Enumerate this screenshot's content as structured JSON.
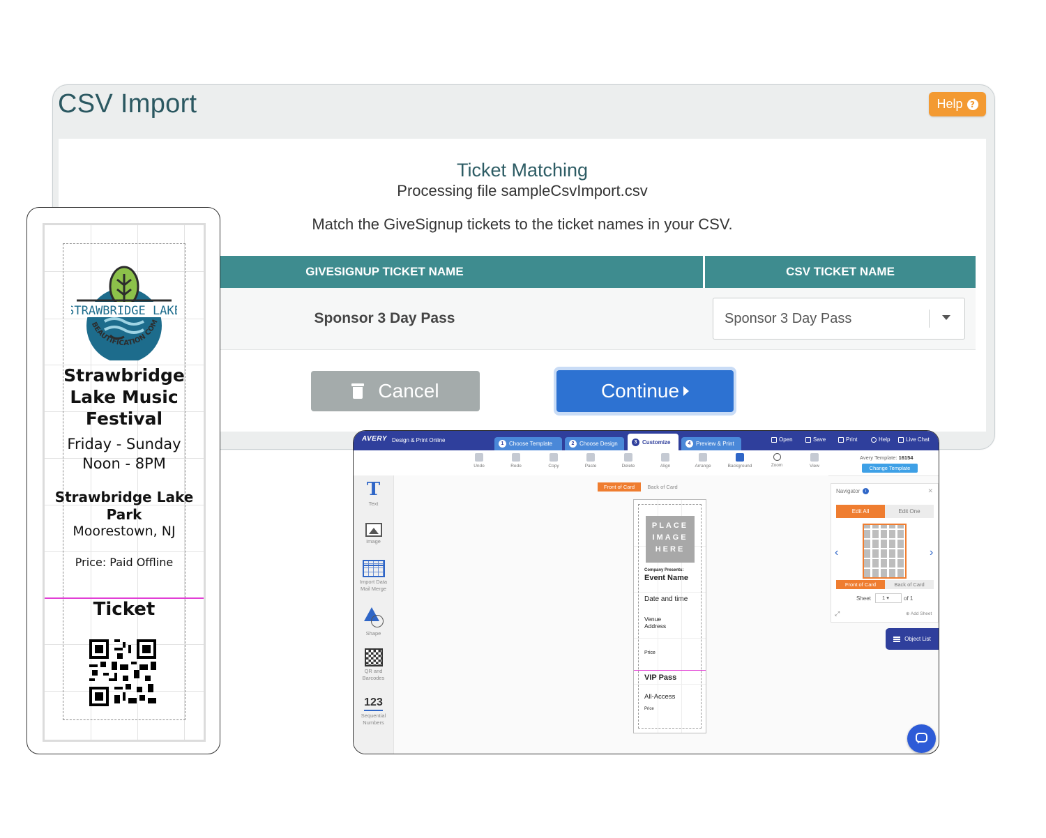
{
  "csv": {
    "title": "CSV Import",
    "help_label": "Help",
    "heading": "Ticket Matching",
    "subheading": "Processing file sampleCsvImport.csv",
    "instruction": "Match the GiveSignup tickets to the ticket names in your CSV.",
    "columns": [
      "GIVESIGNUP TICKET NAME",
      "CSV TICKET NAME"
    ],
    "rows": [
      {
        "ticket_name": "Sponsor 3 Day Pass",
        "csv_name": "Sponsor 3 Day Pass"
      }
    ],
    "cancel_label": "Cancel",
    "continue_label": "Continue"
  },
  "ticket": {
    "logo_text_top": "STRAWBRIDGE LAKE",
    "logo_text_bottom": "BEAUTIFICATION COMMITTEE",
    "event_title": "Strawbridge Lake Music Festival",
    "days": "Friday - Sunday",
    "time": "Noon - 8PM",
    "venue": "Strawbridge Lake Park",
    "city": "Moorestown, NJ",
    "price": "Price: Paid Offline",
    "ticket_label": "Ticket"
  },
  "avery": {
    "brand": "AVERY",
    "app_name": "Design & Print Online",
    "steps": [
      {
        "num": "1",
        "label": "Choose Template"
      },
      {
        "num": "2",
        "label": "Choose Design"
      },
      {
        "num": "3",
        "label": "Customize"
      },
      {
        "num": "4",
        "label": "Preview & Print"
      }
    ],
    "top_links": [
      "Open",
      "Save",
      "Print",
      "Help",
      "Live Chat"
    ],
    "tools": [
      "Undo",
      "Redo",
      "Copy",
      "Paste",
      "Delete",
      "Align",
      "Arrange",
      "Background",
      "Zoom",
      "View"
    ],
    "template_label": "Avery Template:",
    "template_number": "16154",
    "change_template": "Change Template",
    "sidebar": [
      "Text",
      "Image",
      "Import Data Mail Merge",
      "Shape",
      "QR and Barcodes",
      "Sequential Numbers"
    ],
    "sidebar_123": "123",
    "front_tab": "Front of Card",
    "back_tab": "Back of Card",
    "card": {
      "placeholder": "PLACE IMAGE HERE",
      "company_presents": "Company Presents:",
      "event_name": "Event Name",
      "date_time": "Date and time",
      "venue": "Venue",
      "address": "Address",
      "price": "Price",
      "vip": "VIP Pass",
      "all_access": "All-Access",
      "price2": "Price"
    },
    "navigator": {
      "title": "Navigator",
      "edit_all": "Edit All",
      "edit_one": "Edit One",
      "front": "Front of Card",
      "back": "Back of Card",
      "sheet_label": "Sheet",
      "sheet_value": "1",
      "of_label": "of 1",
      "add_sheet": "Add Sheet"
    },
    "object_list": "Object List"
  },
  "colors": {
    "teal_header": "#3e8c8f",
    "help_orange": "#f39a32",
    "continue_blue": "#2d72d2",
    "cancel_gray": "#a4abab",
    "avery_navy": "#2f3f9c",
    "avery_orange": "#ef7d30",
    "ticket_divider_pink": "#e23fd5"
  }
}
